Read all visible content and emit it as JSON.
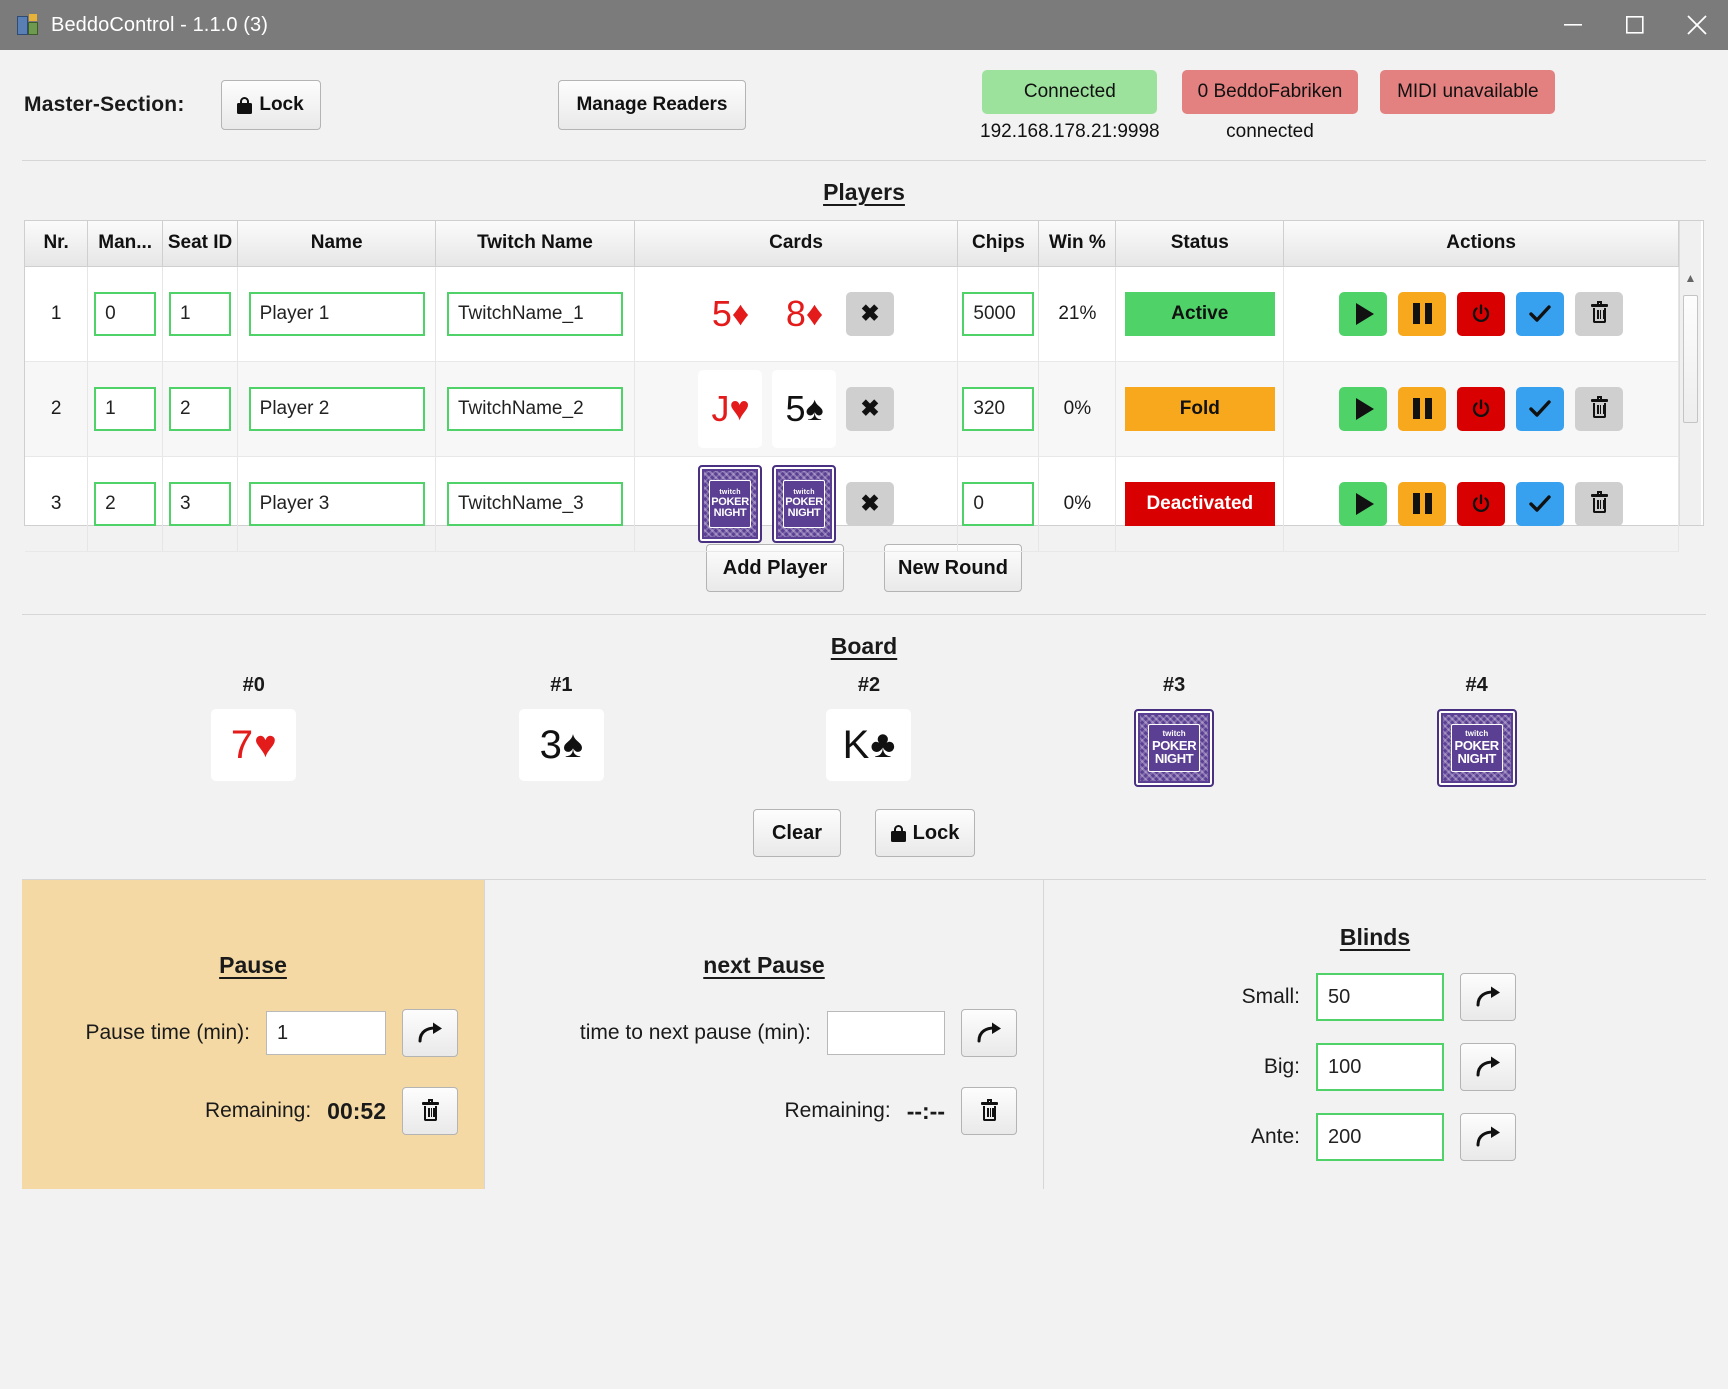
{
  "window": {
    "title": "BeddoControl - 1.1.0 (3)",
    "minimize_icon": "minimize-icon",
    "maximize_icon": "maximize-icon",
    "close_icon": "close-icon"
  },
  "master": {
    "label": "Master-Section:",
    "lock_button": "Lock",
    "manage_readers_button": "Manage Readers",
    "status": [
      {
        "pill": "Connected",
        "sub": "192.168.178.21:9998",
        "color": "#9ce29c"
      },
      {
        "pill": "0 BeddoFabriken",
        "sub": "connected",
        "color": "#e38080"
      },
      {
        "pill": "MIDI unavailable",
        "sub": "",
        "color": "#e38080"
      }
    ]
  },
  "players": {
    "title": "Players",
    "columns": [
      "Nr.",
      "Man...",
      "Seat ID",
      "Name",
      "Twitch Name",
      "Cards",
      "Chips",
      "Win %",
      "Status",
      "Actions"
    ],
    "rows": [
      {
        "nr": "1",
        "manual": "0",
        "seat": "1",
        "name": "Player 1",
        "twitch": "TwitchName_1",
        "cards": [
          {
            "rank": "5",
            "suit": "♦",
            "color": "red",
            "face_up": true,
            "boxed": false
          },
          {
            "rank": "8",
            "suit": "♦",
            "color": "red",
            "face_up": true,
            "boxed": false
          }
        ],
        "chips": "5000",
        "win": "21%",
        "status": "Active",
        "status_kind": "active"
      },
      {
        "nr": "2",
        "manual": "1",
        "seat": "2",
        "name": "Player 2",
        "twitch": "TwitchName_2",
        "cards": [
          {
            "rank": "J",
            "suit": "♥",
            "color": "red",
            "face_up": true,
            "boxed": true
          },
          {
            "rank": "5",
            "suit": "♠",
            "color": "black",
            "face_up": true,
            "boxed": true
          }
        ],
        "chips": "320",
        "win": "0%",
        "status": "Fold",
        "status_kind": "fold"
      },
      {
        "nr": "3",
        "manual": "2",
        "seat": "3",
        "name": "Player 3",
        "twitch": "TwitchName_3",
        "cards": [
          {
            "rank": "",
            "suit": "",
            "color": "",
            "face_up": false,
            "boxed": false
          },
          {
            "rank": "",
            "suit": "",
            "color": "",
            "face_up": false,
            "boxed": false
          }
        ],
        "chips": "0",
        "win": "0%",
        "status": "Deactivated",
        "status_kind": "deact"
      }
    ],
    "row_actions": {
      "clear_cards": "✖",
      "play": "play-icon",
      "pause": "pause-icon",
      "power": "power-icon",
      "confirm": "check-icon",
      "delete": "trash-icon"
    },
    "add_player_button": "Add Player",
    "new_round_button": "New Round",
    "card_back_text": {
      "brand": "twitch",
      "line1": "POKER",
      "line2": "NIGHT"
    }
  },
  "board": {
    "title": "Board",
    "slots": [
      {
        "label": "#0",
        "rank": "7",
        "suit": "♥",
        "color": "red",
        "face_up": true
      },
      {
        "label": "#1",
        "rank": "3",
        "suit": "♠",
        "color": "black",
        "face_up": true
      },
      {
        "label": "#2",
        "rank": "K",
        "suit": "♣",
        "color": "black",
        "face_up": true
      },
      {
        "label": "#3",
        "rank": "",
        "suit": "",
        "color": "",
        "face_up": false
      },
      {
        "label": "#4",
        "rank": "",
        "suit": "",
        "color": "",
        "face_up": false
      }
    ],
    "clear_button": "Clear",
    "lock_button": "Lock"
  },
  "pause_panel": {
    "title": "Pause",
    "time_label": "Pause time (min):",
    "time_value": "1",
    "remaining_label": "Remaining:",
    "remaining_value": "00:52",
    "send_icon": "arrow-forward-icon",
    "delete_icon": "trash-icon",
    "background": "#f4d9a4"
  },
  "next_pause_panel": {
    "title": "next Pause",
    "time_label": "time to next pause (min):",
    "time_value": "",
    "time_placeholder": "",
    "remaining_label": "Remaining:",
    "remaining_value": "--:--",
    "send_icon": "arrow-forward-icon",
    "delete_icon": "trash-icon"
  },
  "blinds_panel": {
    "title": "Blinds",
    "rows": [
      {
        "label": "Small:",
        "value": "50",
        "focused": false
      },
      {
        "label": "Big:",
        "value": "100",
        "focused": false
      },
      {
        "label": "Ante:",
        "value": "200",
        "focused": true
      }
    ],
    "send_icon": "arrow-forward-icon"
  },
  "colors": {
    "accent_green": "#4fd268",
    "accent_orange": "#f8a81c",
    "accent_red": "#d80000",
    "accent_blue": "#38a1ef",
    "titlebar": "#7b7b7b",
    "card_back": "#5b3f93"
  }
}
